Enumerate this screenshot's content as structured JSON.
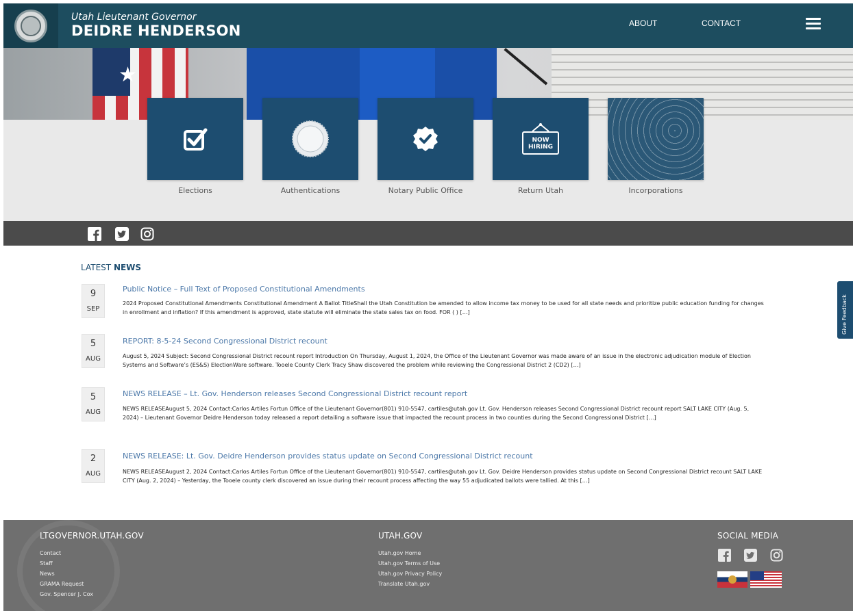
{
  "header": {
    "subtitle": "Utah Lieutenant Governor",
    "title": "DEIDRE HENDERSON",
    "nav": {
      "about": "ABOUT",
      "contact": "CONTACT"
    }
  },
  "services": [
    {
      "label": "Elections",
      "icon": "checkbox-icon"
    },
    {
      "label": "Authentications",
      "icon": "seal-icon"
    },
    {
      "label": "Notary Public Office",
      "icon": "verified-badge-icon"
    },
    {
      "label": "Return Utah",
      "icon": "now-hiring-sign-icon",
      "sign_text_1": "NOW",
      "sign_text_2": "HIRING"
    },
    {
      "label": "Incorporations",
      "icon": "topographic-pattern"
    }
  ],
  "social": [
    "facebook-icon",
    "twitter-icon",
    "instagram-icon"
  ],
  "news": {
    "heading_light": "LATEST",
    "heading_bold": "NEWS",
    "items": [
      {
        "day": "9",
        "month": "SEP",
        "title": "Public Notice – Full Text of Proposed Constitutional Amendments",
        "body": "2024 Proposed Constitutional Amendments Constitutional Amendment A Ballot TitleShall the Utah Constitution be amended to allow income tax money to be used for all state needs and prioritize public education funding for changes in enrollment and inflation? If this amendment is approved, state statute will eliminate the state sales tax on food. FOR ( ) […]"
      },
      {
        "day": "5",
        "month": "AUG",
        "title": "REPORT: 8-5-24 Second Congressional District recount",
        "body": "August 5, 2024 Subject: Second Congressional District recount report Introduction On Thursday, August 1, 2024, the Office of the Lieutenant Governor was made aware of an issue in the electronic adjudication module of Election Systems and Software’s (ES&S) ElectionWare software. Tooele County Clerk Tracy Shaw discovered the problem while reviewing the Congressional District 2 (CD2) […]"
      },
      {
        "day": "5",
        "month": "AUG",
        "title": "NEWS RELEASE – Lt. Gov. Henderson releases Second Congressional District recount report",
        "body": "NEWS RELEASEAugust 5, 2024 Contact:Carlos Artiles Fortun Office of the Lieutenant Governor(801) 910-5547, cartiles@utah.gov Lt. Gov. Henderson releases Second Congressional District recount report SALT LAKE CITY (Aug. 5, 2024) – Lieutenant Governor Deidre Henderson today released a report detailing a software issue that impacted the recount process in two counties during the Second Congressional District […]"
      },
      {
        "day": "2",
        "month": "AUG",
        "title": "NEWS RELEASE: Lt. Gov. Deidre Henderson provides status update on Second Congressional District recount",
        "body": "NEWS RELEASEAugust 2, 2024 Contact:Carlos Artiles Fortun Office of the Lieutenant Governor(801) 910-5547, cartiles@utah.gov Lt. Gov. Deidre Henderson provides status update on Second Congressional District recount SALT LAKE CITY (Aug. 2, 2024) – Yesterday, the Tooele county clerk discovered an issue during their recount process affecting the way 55 adjudicated ballots were tallied. At this […]"
      }
    ]
  },
  "feedback": {
    "label": "Give Feedback"
  },
  "footer": {
    "col1": {
      "heading": "LTGOVERNOR.UTAH.GOV",
      "links": [
        "Contact",
        "Staff",
        "News",
        "GRAMA Request",
        "Gov. Spencer J. Cox"
      ]
    },
    "col2": {
      "heading": "UTAH.GOV",
      "links": [
        "Utah.gov Home",
        "Utah.gov Terms of Use",
        "Utah.gov Privacy Policy",
        "Translate Utah.gov"
      ]
    },
    "col3": {
      "heading": "SOCIAL MEDIA"
    }
  },
  "colors": {
    "header_bg": "#1d4d5f",
    "tile_bg": "#1d4d70",
    "social_bar": "#4b4b4b",
    "footer_bg": "#6f6f6f",
    "link": "#4a77a8"
  }
}
